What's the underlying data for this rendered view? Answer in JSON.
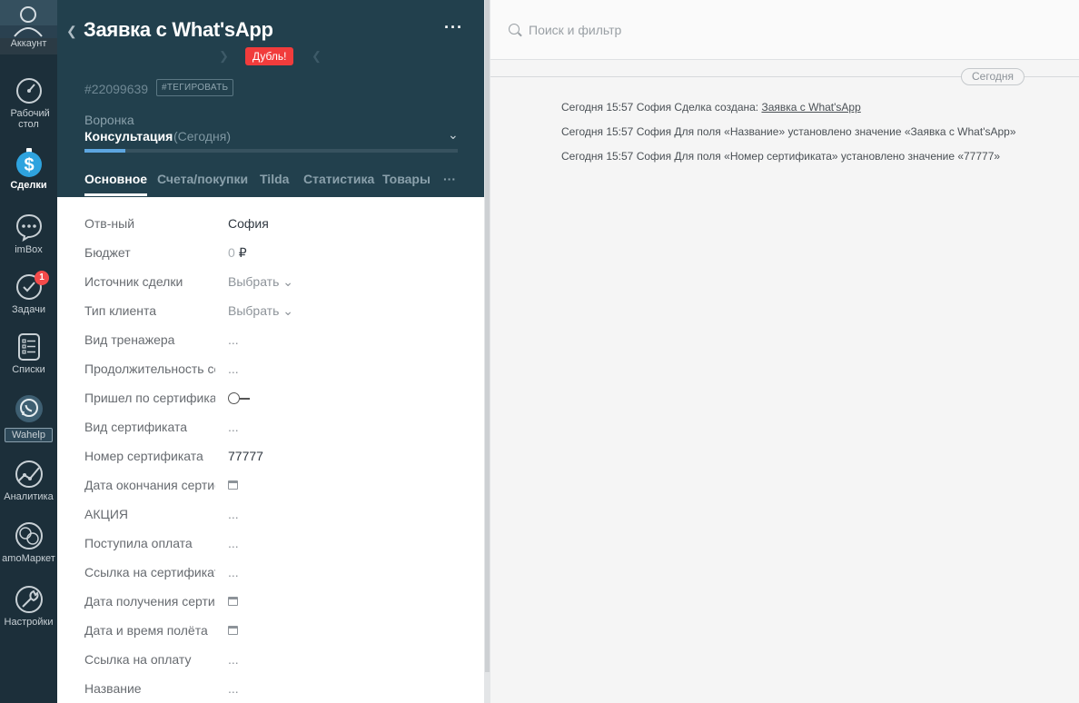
{
  "nav": {
    "account": "Аккаунт",
    "items": [
      {
        "label": "Рабочий стол"
      },
      {
        "label": "Сделки"
      },
      {
        "label": "imBox"
      },
      {
        "label": "Задачи",
        "badge": "1"
      },
      {
        "label": "Списки"
      },
      {
        "label": "Wahelp"
      },
      {
        "label": "Аналитика"
      },
      {
        "label": "amoМаркет"
      },
      {
        "label": "Настройки"
      }
    ],
    "colors": {
      "bg": "#1c2f3a",
      "badge": "#f44a4a"
    }
  },
  "card": {
    "title": "Заявка с What'sApp",
    "duplicate_label": "Дубль!",
    "id": "#22099639",
    "tag_button": "#ТЕГИРОВАТЬ",
    "funnel_label": "Воронка",
    "stage": "Консультация",
    "stage_date": "(Сегодня)",
    "progress": 0.11,
    "tabs": [
      "Основное",
      "Счета/покупки",
      "Tilda",
      "Статистика",
      "Товары"
    ],
    "fields": [
      {
        "label": "Отв-ный",
        "value": "София"
      },
      {
        "label": "Бюджет",
        "value": "0",
        "unit": "₽"
      },
      {
        "label": "Источник сделки",
        "value": "Выбрать"
      },
      {
        "label": "Тип клиента",
        "value": "Выбрать"
      },
      {
        "label": "Вид тренажера",
        "value": "..."
      },
      {
        "label": "Продолжительность сеанса",
        "value": "..."
      },
      {
        "label": "Пришел по сертификату",
        "value": ""
      },
      {
        "label": "Вид сертификата",
        "value": "..."
      },
      {
        "label": "Номер сертификата",
        "value": "77777"
      },
      {
        "label": "Дата окончания сертификата",
        "value": ""
      },
      {
        "label": "АКЦИЯ",
        "value": "..."
      },
      {
        "label": "Поступила оплата",
        "value": "..."
      },
      {
        "label": "Ссылка на сертификат",
        "value": "..."
      },
      {
        "label": "Дата получения сертификата",
        "value": ""
      },
      {
        "label": "Дата и время полёта",
        "value": ""
      },
      {
        "label": "Ссылка на оплату",
        "value": "..."
      },
      {
        "label": "Название",
        "value": "..."
      }
    ],
    "colors": {
      "header": "#22404d",
      "duplicate": "#f13c3c",
      "progress": "#5da6e0"
    }
  },
  "feed": {
    "search_placeholder": "Поиск и фильтр",
    "day_label": "Сегодня",
    "events": [
      {
        "text": "Сегодня 15:57 София Сделка создана: ",
        "link": "Заявка с What'sApp"
      },
      {
        "text": "Сегодня 15:57 София Для поля «Название» установлено значение «Заявка с What'sApp»",
        "link": ""
      },
      {
        "text": "Сегодня 15:57 София Для поля «Номер сертификата» установлено значение «77777»",
        "link": ""
      }
    ]
  }
}
